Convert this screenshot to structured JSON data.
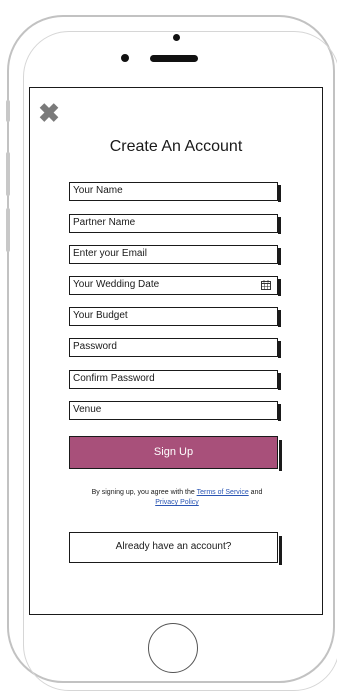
{
  "form": {
    "close_icon": "close-icon",
    "title": "Create An Account",
    "fields": [
      {
        "placeholder": "Your Name"
      },
      {
        "placeholder": "Partner Name"
      },
      {
        "placeholder": "Enter your Email"
      },
      {
        "placeholder": "Your Wedding Date",
        "icon": "calendar-icon"
      },
      {
        "placeholder": "Your Budget"
      },
      {
        "placeholder": "Password"
      },
      {
        "placeholder": "Confirm Password"
      },
      {
        "placeholder": "Venue"
      }
    ],
    "signup_label": "Sign Up",
    "signup_color": "#a8507a",
    "terms_prefix": "By signing up, you agree with the",
    "terms_link": "Terms of Service",
    "terms_and": "and",
    "privacy_link": "Privacy Policy",
    "already_label": "Already have an account?"
  },
  "device": {
    "home_button": "home-button"
  }
}
